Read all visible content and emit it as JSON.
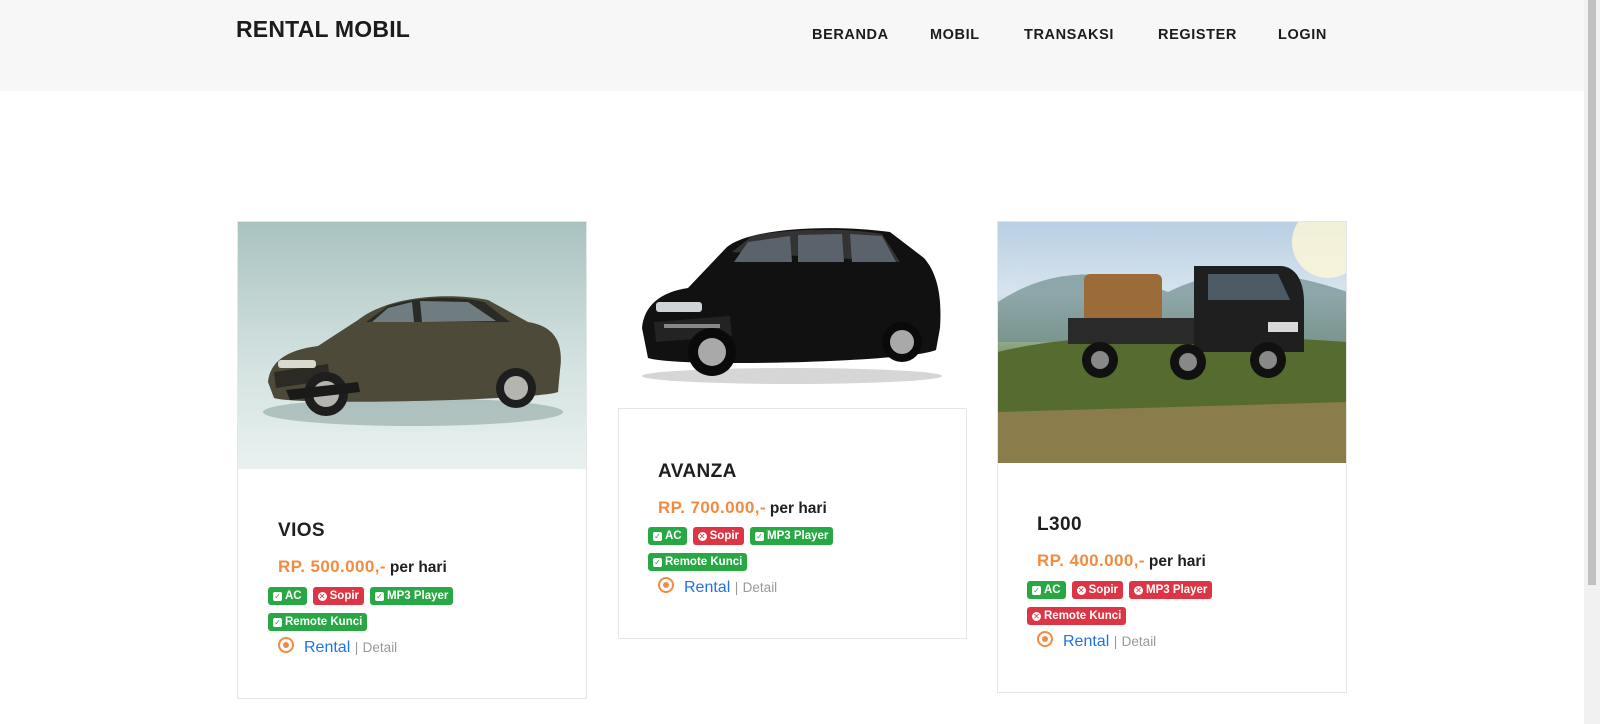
{
  "nav": {
    "brand": "RENTAL MOBIL",
    "links": [
      "BERANDA",
      "MOBIL",
      "TRANSAKSI",
      "REGISTER",
      "LOGIN"
    ]
  },
  "cars": [
    {
      "name": "VIOS",
      "price": "RP. 500.000,-",
      "per": "per hari",
      "features": [
        {
          "label": "AC",
          "available": true
        },
        {
          "label": "Sopir",
          "available": false
        },
        {
          "label": "MP3 Player",
          "available": true
        },
        {
          "label": "Remote Kunci",
          "available": true
        }
      ],
      "rental_label": "Rental",
      "separator": "|",
      "detail_label": "Detail"
    },
    {
      "name": "AVANZA",
      "price": "RP. 700.000,-",
      "per": "per hari",
      "features": [
        {
          "label": "AC",
          "available": true
        },
        {
          "label": "Sopir",
          "available": false
        },
        {
          "label": "MP3 Player",
          "available": true
        },
        {
          "label": "Remote Kunci",
          "available": true
        }
      ],
      "rental_label": "Rental",
      "separator": "|",
      "detail_label": "Detail"
    },
    {
      "name": "L300",
      "price": "RP. 400.000,-",
      "per": "per hari",
      "features": [
        {
          "label": "AC",
          "available": true
        },
        {
          "label": "Sopir",
          "available": false
        },
        {
          "label": "MP3 Player",
          "available": false
        },
        {
          "label": "Remote Kunci",
          "available": false
        }
      ],
      "rental_label": "Rental",
      "separator": "|",
      "detail_label": "Detail"
    }
  ],
  "colors": {
    "accent": "#f28b42",
    "link": "#1e73e8",
    "available": "#28a745",
    "unavailable": "#dc3545",
    "navbar_bg": "#f7f7f7"
  }
}
